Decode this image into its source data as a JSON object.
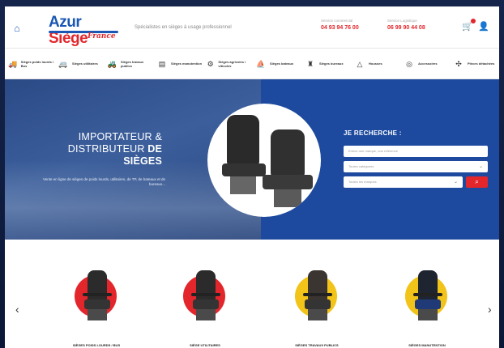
{
  "header": {
    "logo": {
      "primary": "Azur",
      "secondary": "Siège",
      "sub": "France"
    },
    "tagline": "Spécialistes en sièges à usage professionnel",
    "contact1": {
      "label": "Service commercial",
      "phone": "04 93 94 76 00"
    },
    "contact2": {
      "label": "Service Logistique",
      "phone": "06 99 90 44 08"
    },
    "icons": {
      "home": "home-icon",
      "cart": "cart-icon",
      "user": "user-icon"
    }
  },
  "categories": [
    {
      "label": "Sièges poids lourds / Bus",
      "icon": "truck-icon"
    },
    {
      "label": "Sièges utilitaires",
      "icon": "van-icon"
    },
    {
      "label": "Sièges travaux publics",
      "icon": "excavator-icon"
    },
    {
      "label": "Sièges manutention",
      "icon": "forklift-icon"
    },
    {
      "label": "Sièges agricoles / viticoles",
      "icon": "tractor-icon"
    },
    {
      "label": "Sièges bateaux",
      "icon": "boat-icon"
    },
    {
      "label": "Sièges bureaux",
      "icon": "office-chair-icon"
    },
    {
      "label": "Housses",
      "icon": "cover-icon"
    },
    {
      "label": "Accessoires",
      "icon": "accessory-icon"
    },
    {
      "label": "Pièces détachées",
      "icon": "parts-icon"
    }
  ],
  "hero": {
    "title_line1": "IMPORTATEUR &",
    "title_line2_pre": "DISTRIBUTEUR ",
    "title_line2_bold": "DE",
    "title_line3": "SIÈGES",
    "description": "Vente en ligne de sièges de poids lourds, utilitaires, de TP, de bateaux et de bureaux..."
  },
  "search": {
    "title": "JE RECHERCHE :",
    "placeholder_ref": "Entrez une marque, une référence",
    "category_value": "Toutes catégories",
    "brand_value": "Toutes les marques",
    "submit_icon": "search-icon"
  },
  "products": [
    {
      "label": "SIÈGES POIDS LOURDS / BUS",
      "color": "#e3262c"
    },
    {
      "label": "SIÈGE UTILITAIRES",
      "color": "#e3262c"
    },
    {
      "label": "SIÈGES TRAVAUX PUBLICS",
      "color": "#f2c318"
    },
    {
      "label": "SIÈGES MANUTENTION",
      "color": "#f2c318"
    }
  ],
  "colors": {
    "brand_blue": "#1a56b3",
    "brand_red": "#e3262c",
    "hero_blue": "#1d4a9e"
  }
}
